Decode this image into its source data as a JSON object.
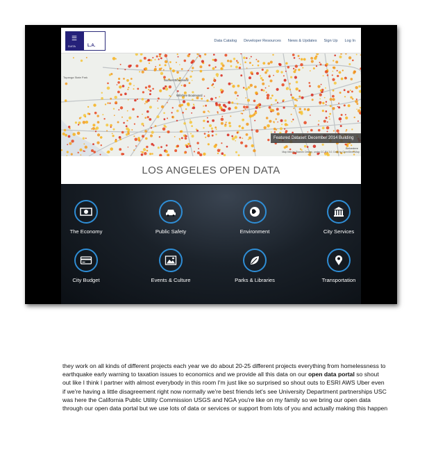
{
  "logo": {
    "top_small": "DATA",
    "brand": "L.A."
  },
  "nav": [
    "Data Catalog",
    "Developer Resources",
    "News & Updates",
    "Sign Up",
    "Log In"
  ],
  "map": {
    "labels": [
      "Topanga State Park",
      "Wilshire Boulevard",
      "Sunset Boulevard",
      "Belvedere"
    ],
    "featured": "Featured Dataset: December 2014 Building",
    "attribution": "Map tiles by Stamen Design, under CC BY 3.0. Data by OpenStreetMap"
  },
  "site_title": "LOS ANGELES OPEN DATA",
  "categories": [
    {
      "label": "The Economy",
      "icon": "money-icon"
    },
    {
      "label": "Public Safety",
      "icon": "car-icon"
    },
    {
      "label": "Environment",
      "icon": "globe-icon"
    },
    {
      "label": "City Services",
      "icon": "building-icon"
    },
    {
      "label": "City Budget",
      "icon": "credit-card-icon"
    },
    {
      "label": "Events & Culture",
      "icon": "picture-icon"
    },
    {
      "label": "Parks & Libraries",
      "icon": "leaf-icon"
    },
    {
      "label": "Transportation",
      "icon": "map-pin-icon"
    }
  ],
  "transcript": {
    "before": "they work on all kinds of different projects each year we do about 20-25 different projects everything from homelessness to earthquake early warning to taxation issues to economics and we provide all this data on our ",
    "bold": "open data portal",
    "after": " so shout out like I think I partner with almost everybody in this room I'm just like so surprised so shout outs to ESRI AWS Uber even if we're having a little disagreement right now normally we're best friends let's see University Department partnerships USC was here the California Public Utility Commission USGS and NGA you're like on my family so we bring our open data through our open data portal but we use lots of data or services or support from lots of you and actually making this happen"
  },
  "colors": {
    "accent": "#2f8ed6",
    "logo": "#25217a"
  }
}
